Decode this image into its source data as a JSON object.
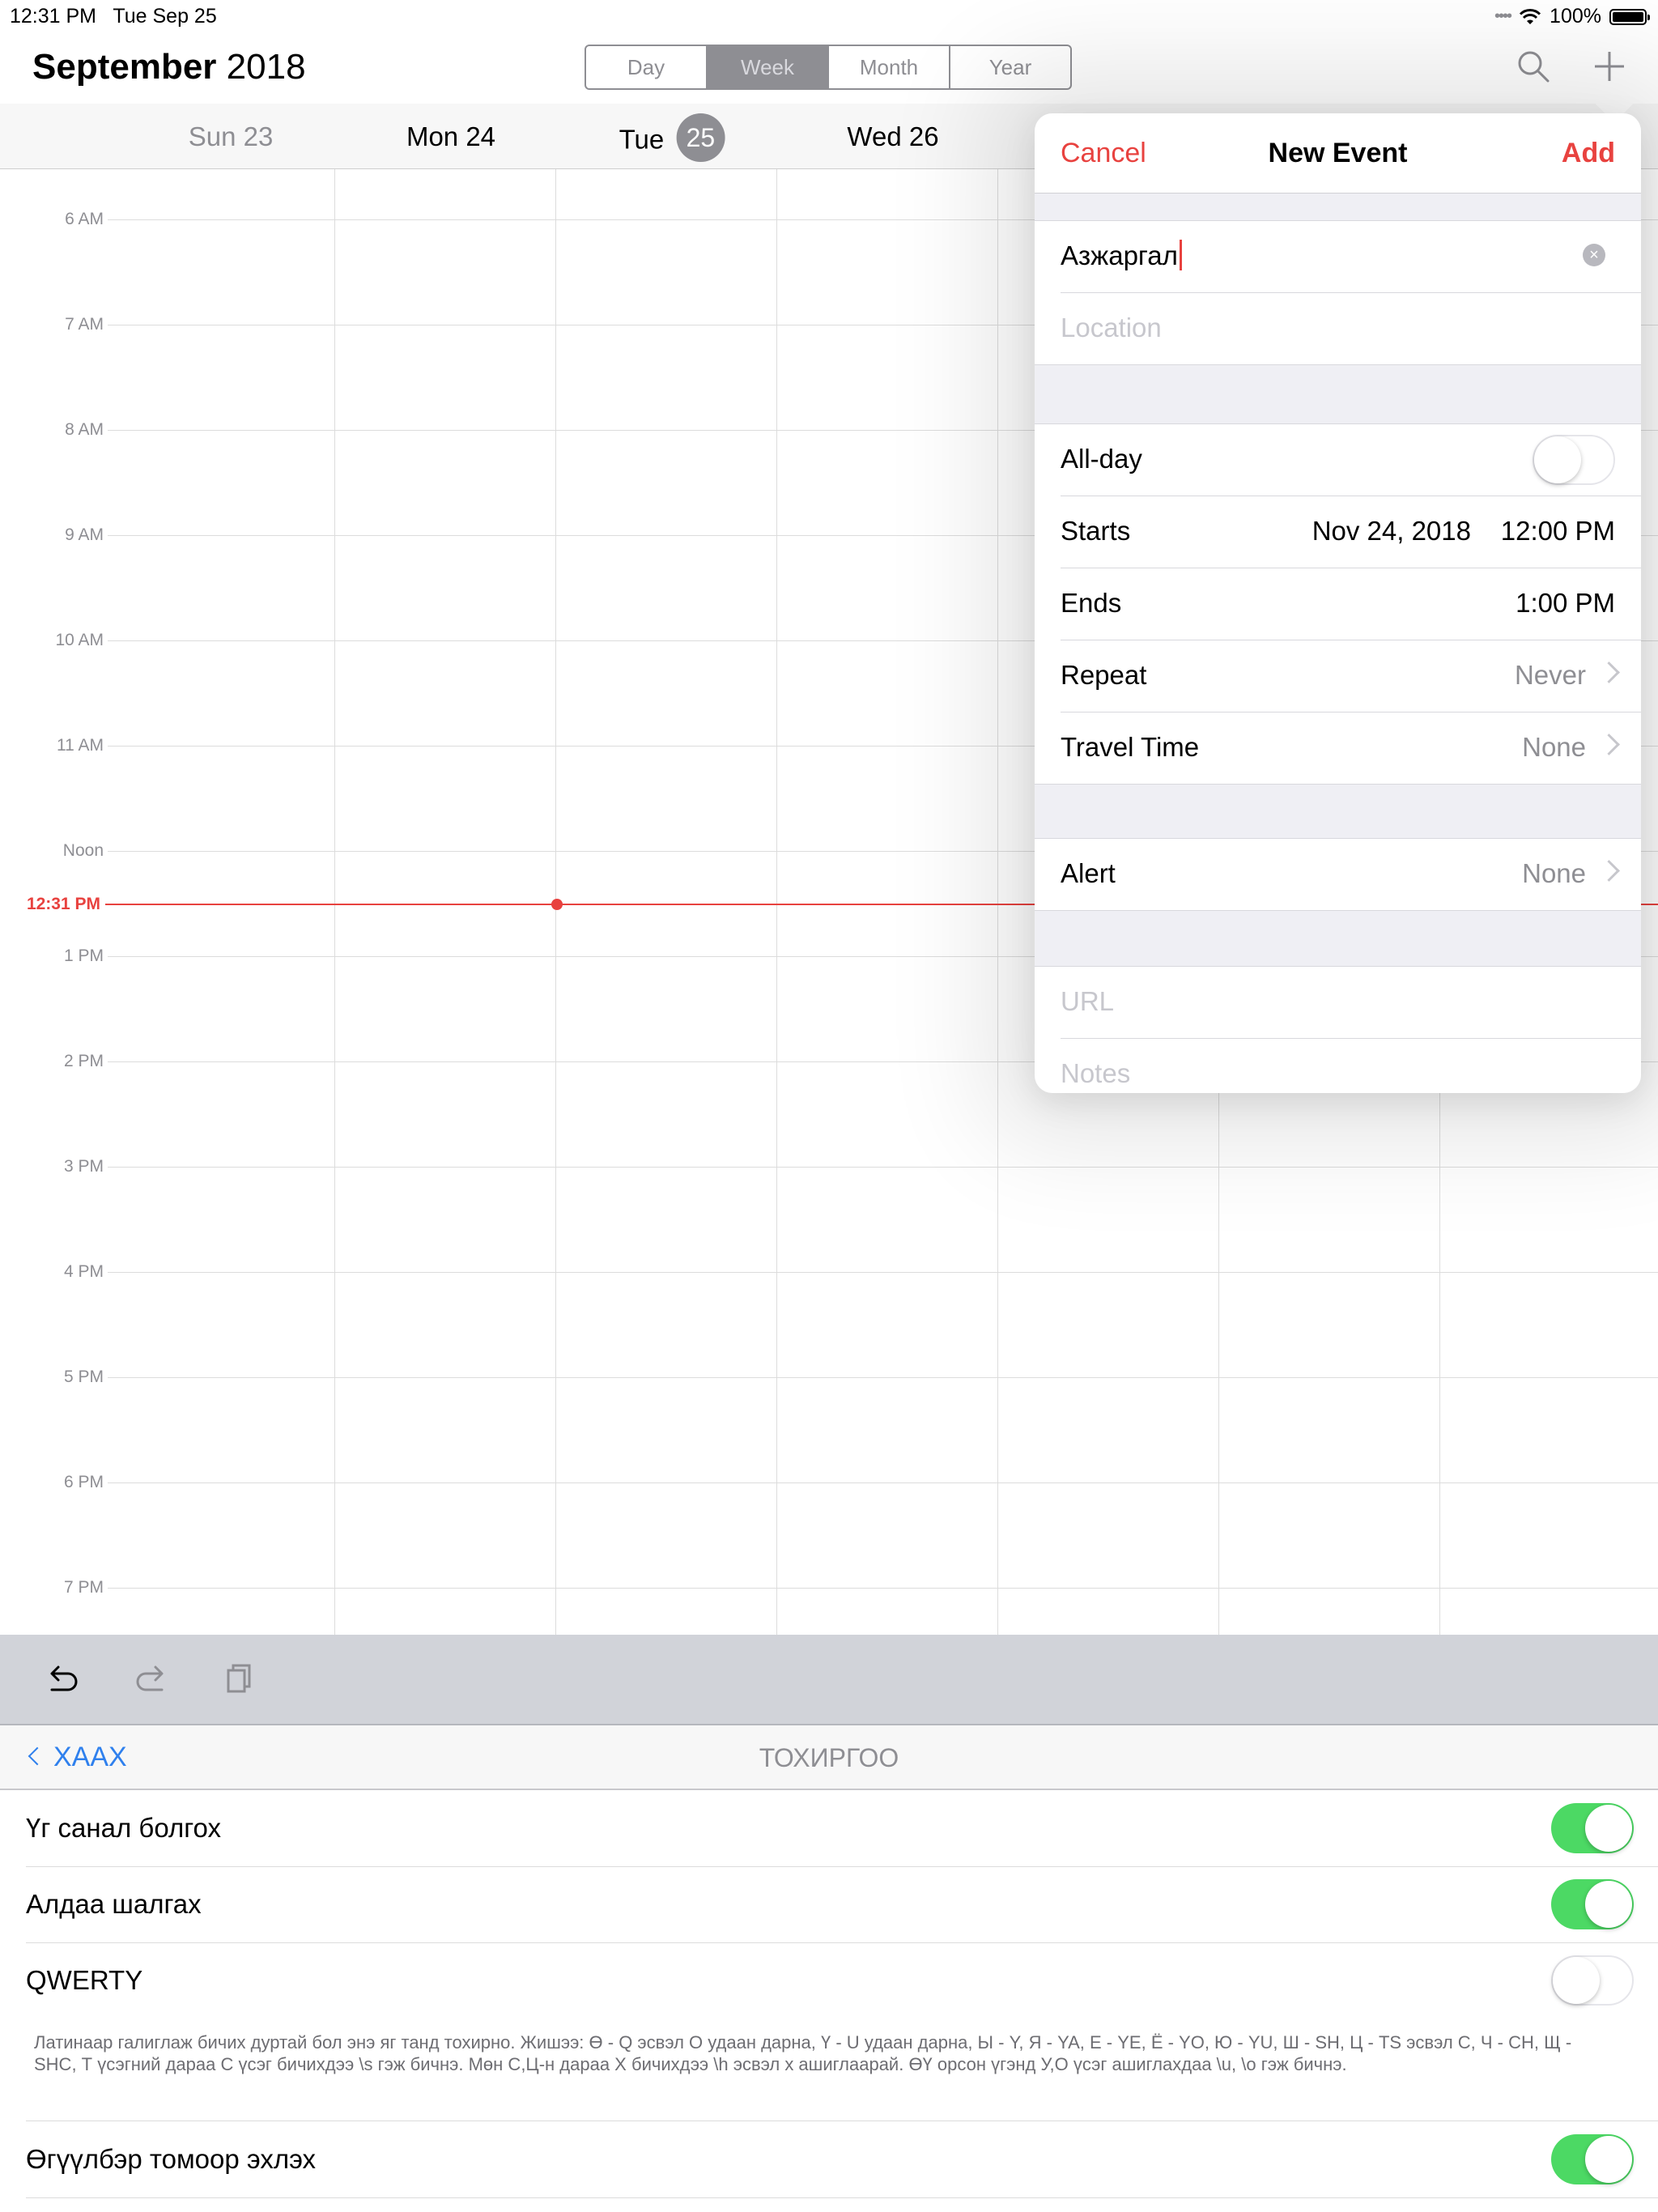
{
  "status_bar": {
    "time": "12:31 PM",
    "date": "Tue Sep 25",
    "battery": "100%"
  },
  "header": {
    "month": "September",
    "year": "2018",
    "view_tabs": [
      "Day",
      "Week",
      "Month",
      "Year"
    ],
    "active_tab": "Week"
  },
  "day_headers": [
    {
      "name": "Sun 23",
      "dim": true
    },
    {
      "name": "Mon 24",
      "dim": false
    },
    {
      "name": "Tue",
      "badge": "25",
      "today": true
    },
    {
      "name": "Wed 26",
      "dim": false
    }
  ],
  "hours": [
    "6 AM",
    "7 AM",
    "8 AM",
    "9 AM",
    "10 AM",
    "11 AM",
    "Noon",
    "1 PM",
    "2 PM",
    "3 PM",
    "4 PM",
    "5 PM",
    "6 PM",
    "7 PM"
  ],
  "now_label": "12:31 PM",
  "new_event": {
    "cancel": "Cancel",
    "title": "New Event",
    "add": "Add",
    "event_title_value": "Азжаргал",
    "location_placeholder": "Location",
    "allday_label": "All-day",
    "allday_on": false,
    "starts_label": "Starts",
    "starts_date": "Nov 24, 2018",
    "starts_time": "12:00 PM",
    "ends_label": "Ends",
    "ends_time": "1:00 PM",
    "repeat_label": "Repeat",
    "repeat_value": "Never",
    "travel_label": "Travel Time",
    "travel_value": "None",
    "alert_label": "Alert",
    "alert_value": "None",
    "url_placeholder": "URL",
    "notes_placeholder": "Notes"
  },
  "keyboard_settings": {
    "back": "ХААХ",
    "title": "ТОХИРГОО",
    "rows": [
      {
        "label": "Үг санал болгох",
        "on": true
      },
      {
        "label": "Алдаа шалгах",
        "on": true
      },
      {
        "label": "QWERTY",
        "on": false
      }
    ],
    "note": "Латинаар галиглаж бичих дуртай бол энэ яг танд тохирно. Жишээ: Ө - Q эсвэл О удаан дарна, Ү - U удаан дарна, Ы - Y, Я - YA, Е - YE, Ё - YO, Ю - YU, Ш - SH, Ц - TS эсвэл C, Ч - CH, Щ - SHC, Т үсэгний дараа С үсэг бичихдээ \\s гэж бичнэ. Мөн С,Ц-н дараа Х бичихдээ \\h эсвэл х ашиглаарай. ӨҮ орсон үгэнд У,О үсэг ашиглахдаа \\u, \\o гэж бичнэ.",
    "last_row": {
      "label": "Өгүүлбэр томоор эхлэх",
      "on": true
    }
  }
}
